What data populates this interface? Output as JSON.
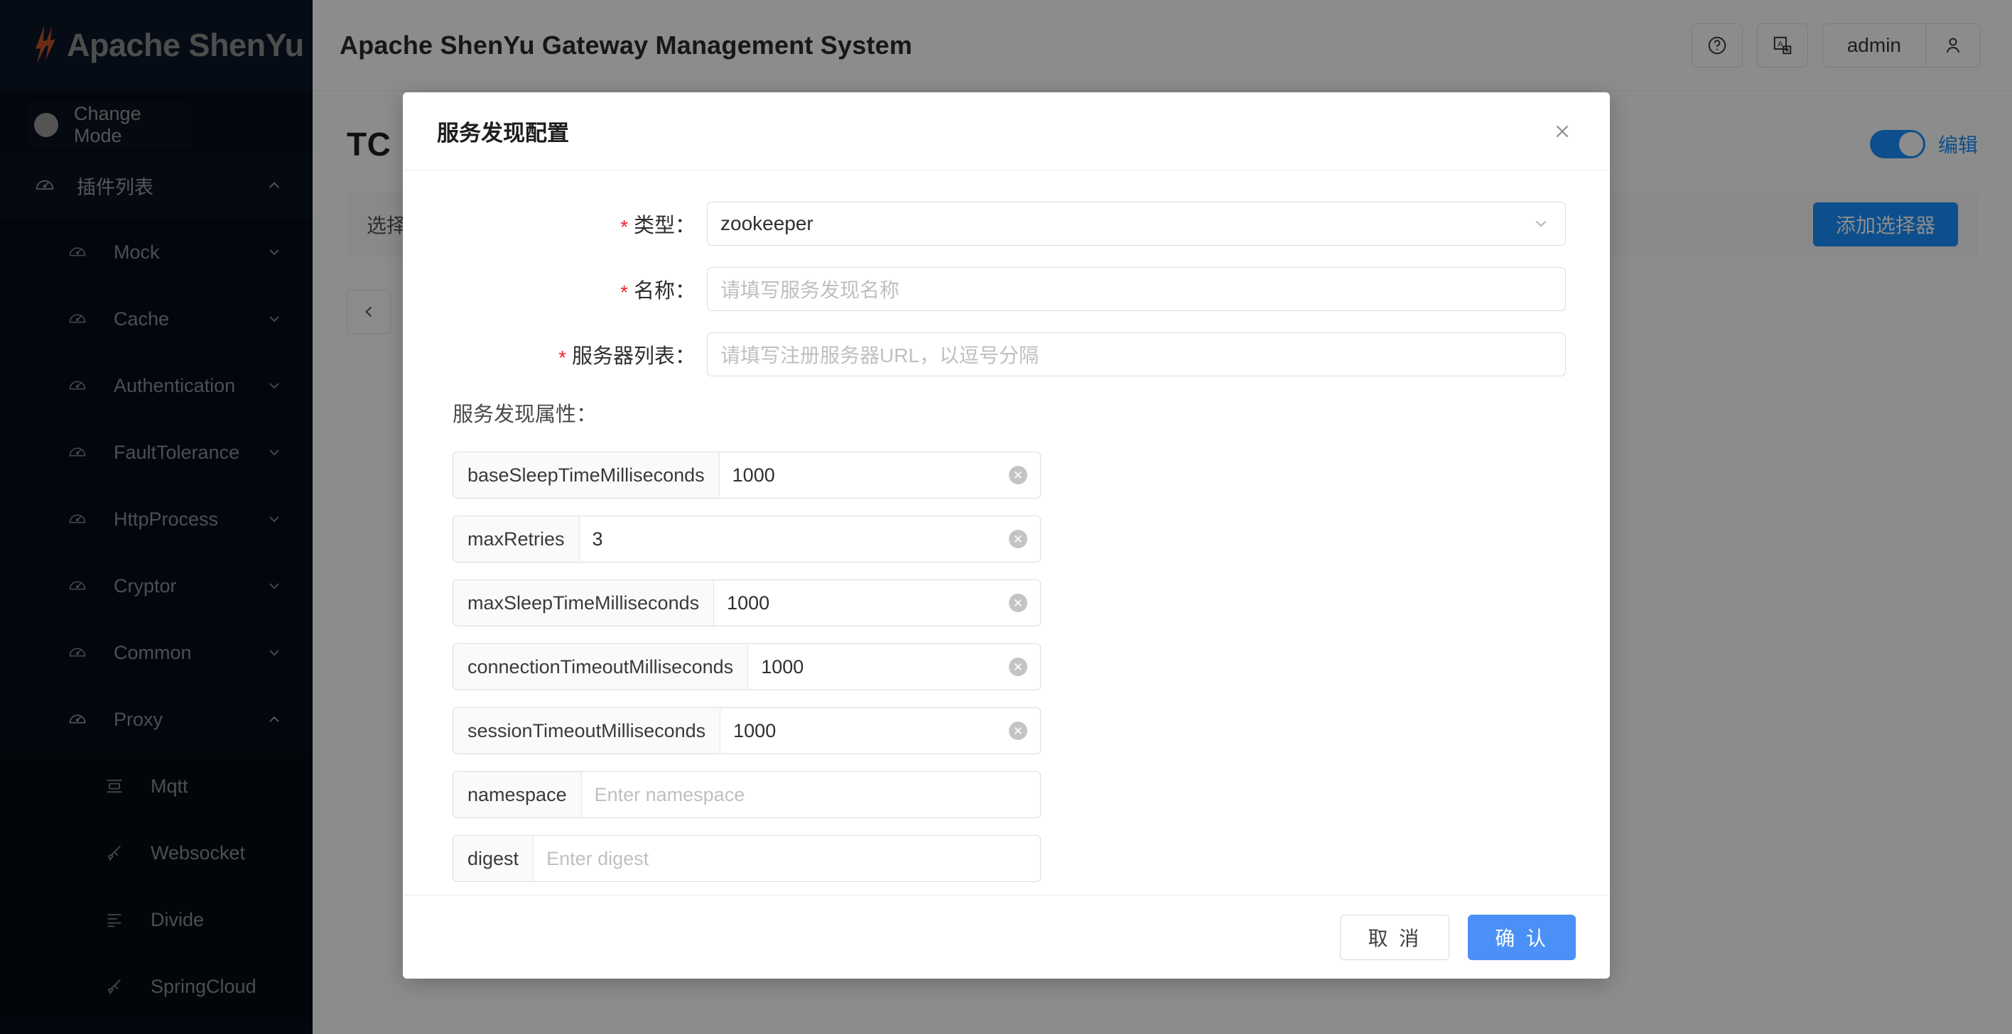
{
  "sidebar": {
    "brand": "Apache ShenYu",
    "change_mode": "Change Mode",
    "plugin_list": "插件列表",
    "items": [
      {
        "label": "Mock",
        "icon": "gauge-icon",
        "arrow": "chevron-down-icon"
      },
      {
        "label": "Cache",
        "icon": "gauge-icon",
        "arrow": "chevron-down-icon"
      },
      {
        "label": "Authentication",
        "icon": "gauge-icon",
        "arrow": "chevron-down-icon"
      },
      {
        "label": "FaultTolerance",
        "icon": "gauge-icon",
        "arrow": "chevron-down-icon"
      },
      {
        "label": "HttpProcess",
        "icon": "gauge-icon",
        "arrow": "chevron-down-icon"
      },
      {
        "label": "Cryptor",
        "icon": "gauge-icon",
        "arrow": "chevron-down-icon"
      },
      {
        "label": "Common",
        "icon": "gauge-icon",
        "arrow": "chevron-down-icon"
      },
      {
        "label": "Proxy",
        "icon": "gauge-icon",
        "arrow": "chevron-up-icon"
      }
    ],
    "proxy_children": [
      {
        "label": "Mqtt",
        "icon": "list-box-icon"
      },
      {
        "label": "Websocket",
        "icon": "marker-icon"
      },
      {
        "label": "Divide",
        "icon": "align-left-icon"
      },
      {
        "label": "SpringCloud",
        "icon": "marker-icon"
      }
    ]
  },
  "topbar": {
    "app_title": "Apache ShenYu Gateway Management System",
    "help_icon": "question-circle-icon",
    "translate_icon": "translation-icon",
    "user_name": "admin",
    "user_icon": "user-icon"
  },
  "page": {
    "title": "TC",
    "edit_switch_label": "编辑",
    "toolbar_text": "选择",
    "add_selector_button": "添加选择器",
    "prev_page_icon": "chevron-left-icon"
  },
  "modal": {
    "title": "服务发现配置",
    "close_icon": "close-icon",
    "fields": [
      {
        "label": "类型：",
        "required": true,
        "kind": "select",
        "value": "zookeeper",
        "placeholder": "",
        "arrow_icon": "chevron-down-icon"
      },
      {
        "label": "名称：",
        "required": true,
        "kind": "input",
        "value": "",
        "placeholder": "请填写服务发现名称"
      },
      {
        "label": "服务器列表：",
        "required": true,
        "kind": "input",
        "value": "",
        "placeholder": "请填写注册服务器URL，以逗号分隔"
      }
    ],
    "props_label": "服务发现属性：",
    "props": [
      {
        "key": "baseSleepTimeMilliseconds",
        "value": "1000",
        "placeholder": "",
        "clearable": true
      },
      {
        "key": "maxRetries",
        "value": "3",
        "placeholder": "",
        "clearable": true
      },
      {
        "key": "maxSleepTimeMilliseconds",
        "value": "1000",
        "placeholder": "",
        "clearable": true
      },
      {
        "key": "connectionTimeoutMilliseconds",
        "value": "1000",
        "placeholder": "",
        "clearable": true
      },
      {
        "key": "sessionTimeoutMilliseconds",
        "value": "1000",
        "placeholder": "",
        "clearable": true
      },
      {
        "key": "namespace",
        "value": "",
        "placeholder": "Enter namespace",
        "clearable": false
      },
      {
        "key": "digest",
        "value": "",
        "placeholder": "Enter digest",
        "clearable": false
      }
    ],
    "cancel_button": "取 消",
    "confirm_button": "确 认"
  },
  "colors": {
    "sidebar_bg": "#060d18",
    "brand_bg": "#0b1628",
    "accent_blue": "#1890ff",
    "confirm_blue": "#4a90f7",
    "required_red": "#f5222d",
    "logo_orange": "#c0522a"
  }
}
